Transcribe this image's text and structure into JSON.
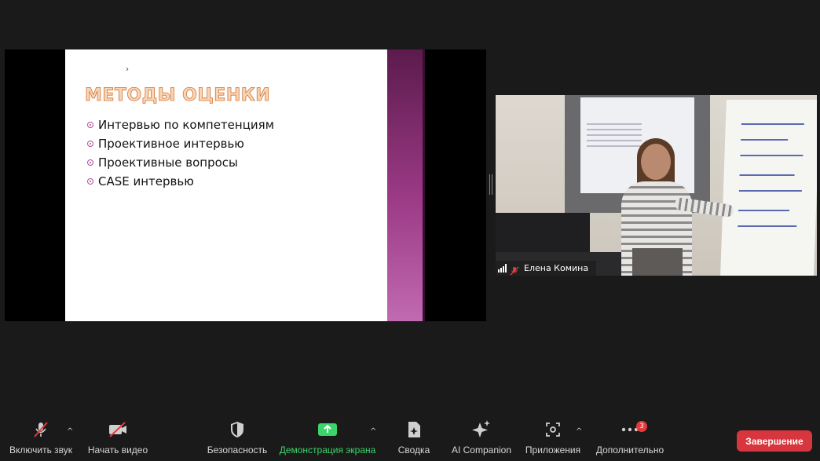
{
  "slide": {
    "title": "МЕТОДЫ ОЦЕНКИ",
    "bullets": [
      "Интервью по компетенциям",
      "Проективное интервью",
      "Проективные вопросы",
      "CASE интервью"
    ],
    "cursor_glyph": "›"
  },
  "participant": {
    "name": "Елена Комина"
  },
  "toolbar": {
    "audio_label": "Включить звук",
    "video_label": "Начать видео",
    "security_label": "Безопасность",
    "share_label": "Демонстрация экрана",
    "summary_label": "Сводка",
    "ai_label": "AI Companion",
    "apps_label": "Приложения",
    "more_label": "Дополнительно",
    "more_badge": "3",
    "end_label": "Завершение"
  },
  "colors": {
    "share_green": "#3cd36a",
    "end_red": "#d7363e",
    "slide_accent": "#9c3a86",
    "title_orange": "#d9732f"
  },
  "icons": {
    "audio": "mic-muted-icon",
    "video": "camera-off-icon",
    "security": "shield-icon",
    "share": "share-screen-icon",
    "summary": "document-sparkle-icon",
    "ai": "sparkle-icon",
    "apps": "apps-icon",
    "more": "more-dots-icon"
  }
}
